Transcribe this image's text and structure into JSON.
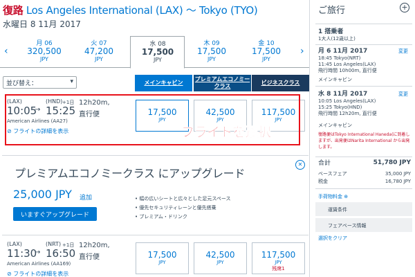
{
  "header": {
    "direction": "復路",
    "route": " Los Angeles International (LAX) 〜 Tokyo (TYO)",
    "date": "水曜日 8 11月 2017"
  },
  "date_strip": [
    {
      "label": "月 06",
      "price": "320,500",
      "currency": "JPY"
    },
    {
      "label": "火 07",
      "price": "47,200",
      "currency": "JPY"
    },
    {
      "label": "水 08",
      "price": "17,500",
      "currency": "JPY"
    },
    {
      "label": "木 09",
      "price": "17,500",
      "currency": "JPY"
    },
    {
      "label": "金 10",
      "price": "17,500",
      "currency": "JPY"
    }
  ],
  "nav": {
    "prev": "‹",
    "next": "›"
  },
  "sort": {
    "label": "並び替え：",
    "caret": "▾"
  },
  "cabins": [
    "メインキャビン",
    "プレミアムエコノミークラス",
    "ビジネスクラス"
  ],
  "flights": [
    {
      "orig": "(LAX)",
      "dep": "10:05",
      "arrow": "→",
      "dest": "(HND)",
      "plus": "+1日",
      "arr": "15:25",
      "duration": "12h20m,",
      "type": "直行便",
      "airline": "American Airlines (AA27)",
      "details": "⊘ フライトの詳細を表示",
      "fares": [
        {
          "price": "17,500",
          "currency": "JPY",
          "note": ""
        },
        {
          "price": "42,500",
          "currency": "JPY",
          "note": ""
        },
        {
          "price": "117,500",
          "currency": "JPY",
          "note": ""
        }
      ]
    },
    {
      "orig": "(LAX)",
      "dep": "11:30",
      "arrow": "→",
      "dest": "(NRT)",
      "plus": "+1日",
      "arr": "16:50",
      "duration": "12h20m,",
      "type": "直行便",
      "airline": "American Airlines (AA169)",
      "details": "⊘ フライトの詳細を表示",
      "fares": [
        {
          "price": "17,500",
          "currency": "JPY",
          "note": ""
        },
        {
          "price": "42,500",
          "currency": "JPY",
          "note": ""
        },
        {
          "price": "117,500",
          "currency": "JPY",
          "note": "残席1"
        }
      ]
    }
  ],
  "overlay_text": "フライトを選択",
  "upgrade": {
    "title": "プレミアムエコノミークラス にアップグレード",
    "price": "25,000 JPY",
    "add": "追加",
    "button": "いますぐアップグレード",
    "features": [
      "幅の広いシートと広々とした足元スペース",
      "優先セキュリティレーンと優先搭乗",
      "プレミアム・ドリンク"
    ],
    "close": "✕"
  },
  "sidebar": {
    "title": "ご旅行",
    "plus": "+",
    "passenger_count": "1 搭乗者",
    "passenger_type": "1大人(12歳以上)",
    "leg1": {
      "date": "月 6 11月 2017",
      "link": "変更",
      "l1": "18:45 Tokyo(NRT)",
      "l2": "11:45 Los Angeles(LAX)",
      "l3": "飛行時間 10h00m, 直行便",
      "cabin": "メインキャビン"
    },
    "leg2": {
      "date": "水 8 11月 2017",
      "link": "変更",
      "l1": "10:05 Los Angeles(LAX)",
      "l2": "15:25 Tokyo(HND)",
      "l3": "飛行時間 12h20m, 直行便",
      "cabin": "メインキャビン",
      "warning": "復路便はTokyo International Haneda(に到着しますが、出発便はNarita International から出発します。"
    },
    "total_label": "合計",
    "total_value": "51,780 JPY",
    "fare_label": "ベースフェア",
    "fare_value": "35,000 JPY",
    "tax_label": "税金",
    "tax_value": "16,780 JPY",
    "baggage_link": "手荷物料金 ⊕",
    "terms": "運賃条件",
    "fare_info": "フェアベース情報",
    "clear": "選択をクリア"
  }
}
